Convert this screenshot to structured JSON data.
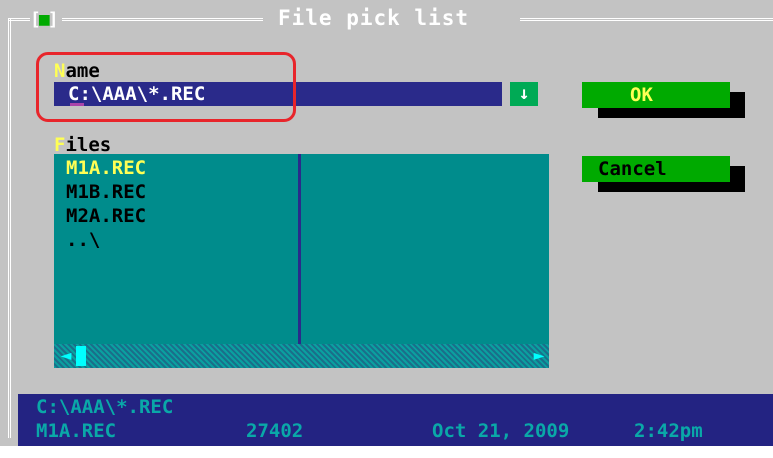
{
  "dialog": {
    "title": "File pick list",
    "close_glyph_left": "[",
    "close_glyph_mid": "■",
    "close_glyph_right": "]"
  },
  "name_field": {
    "label_hot": "N",
    "label_rest": "ame",
    "value": "C:\\AAA\\*.REC",
    "dropdown_glyph": "↓"
  },
  "files": {
    "label_hot": "F",
    "label_rest": "iles",
    "items": [
      "M1A.REC",
      "M1B.REC",
      "M2A.REC",
      "..\\"
    ],
    "selected_index": 0
  },
  "scrollbar": {
    "left_glyph": "◄",
    "right_glyph": "►"
  },
  "buttons": {
    "ok_label": "OK",
    "cancel_label": "Cancel"
  },
  "status": {
    "path": "C:\\AAA\\*.REC",
    "file_name": "M1A.REC",
    "file_size": "27402",
    "date": "Oct 21, 2009",
    "time": "2:42pm"
  },
  "colors": {
    "background": "#c3c3c3",
    "input_bg": "#2a2a8a",
    "list_bg": "#008c8c",
    "button_bg": "#00aa00",
    "highlight": "#e8252b",
    "status_bg": "#232382"
  }
}
